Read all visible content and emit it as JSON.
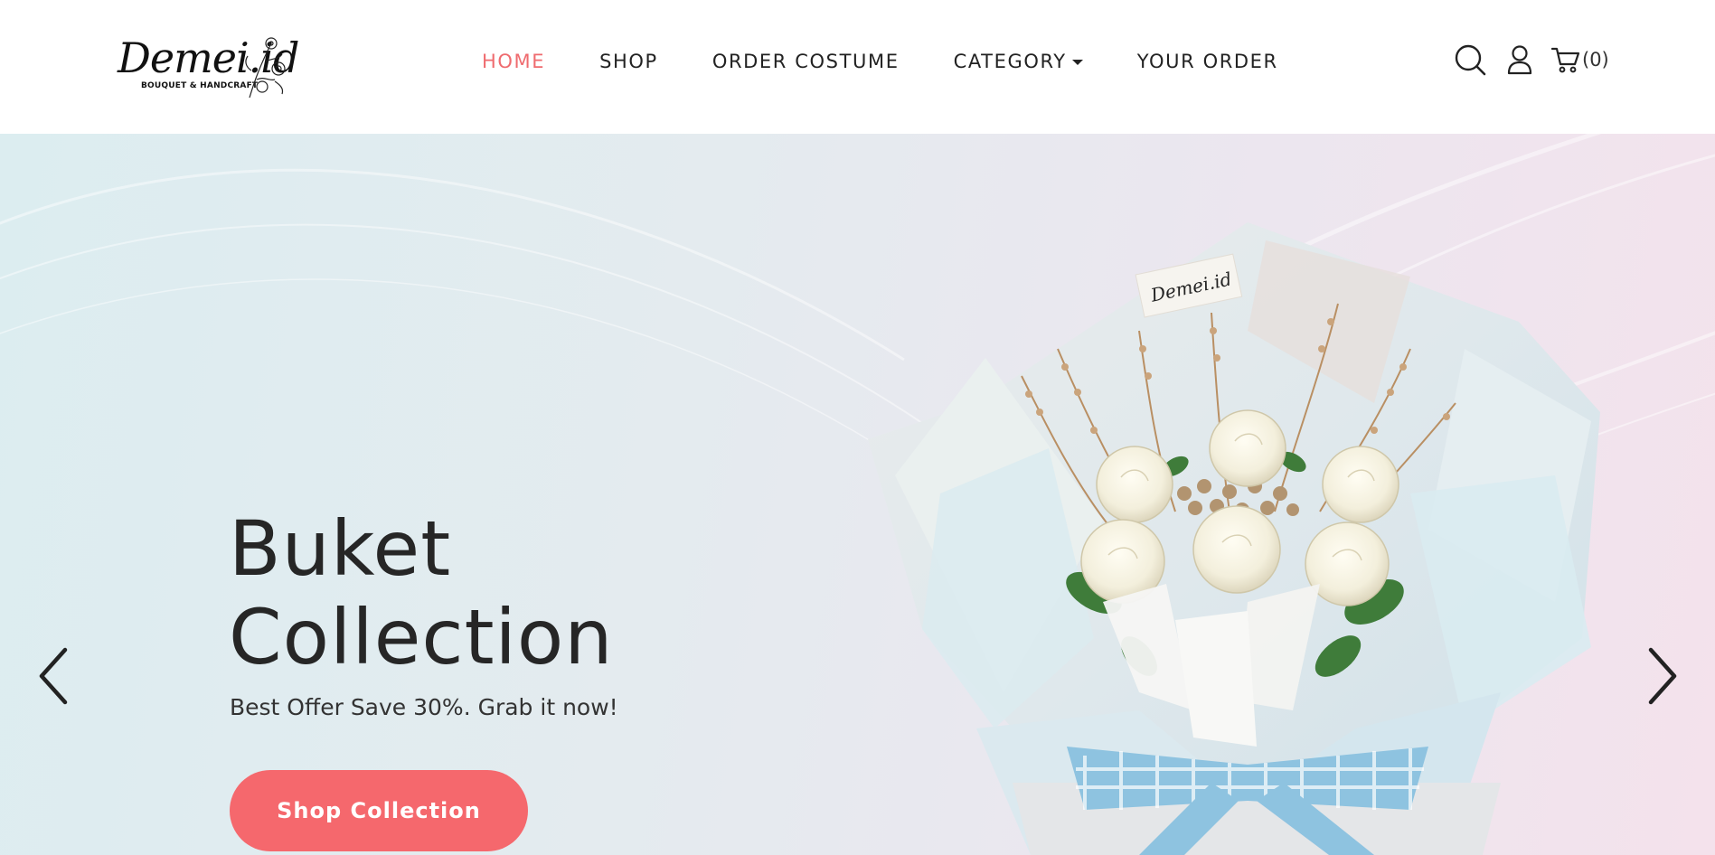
{
  "brand": {
    "logo_text": "Demei.id",
    "logo_tagline": "BOUQUET & HANDCRAFT"
  },
  "nav": {
    "items": [
      {
        "label": "HOME",
        "active": true
      },
      {
        "label": "SHOP",
        "active": false
      },
      {
        "label": "ORDER COSTUME",
        "active": false
      },
      {
        "label": "CATEGORY",
        "active": false,
        "has_dropdown": true
      },
      {
        "label": "YOUR ORDER",
        "active": false
      }
    ]
  },
  "header_icons": {
    "search": "search-icon",
    "account": "user-icon",
    "cart": "cart-icon",
    "cart_count": "(0)"
  },
  "hero": {
    "title_line1": "Buket",
    "title_line2": "Collection",
    "subtitle": "Best Offer Save 30%. Grab it now!",
    "button_label": "Shop Collection",
    "wrap_label": "Demei.id"
  },
  "colors": {
    "accent": "#f5686d",
    "active_nav": "#ef6b6f",
    "text": "#222222"
  }
}
